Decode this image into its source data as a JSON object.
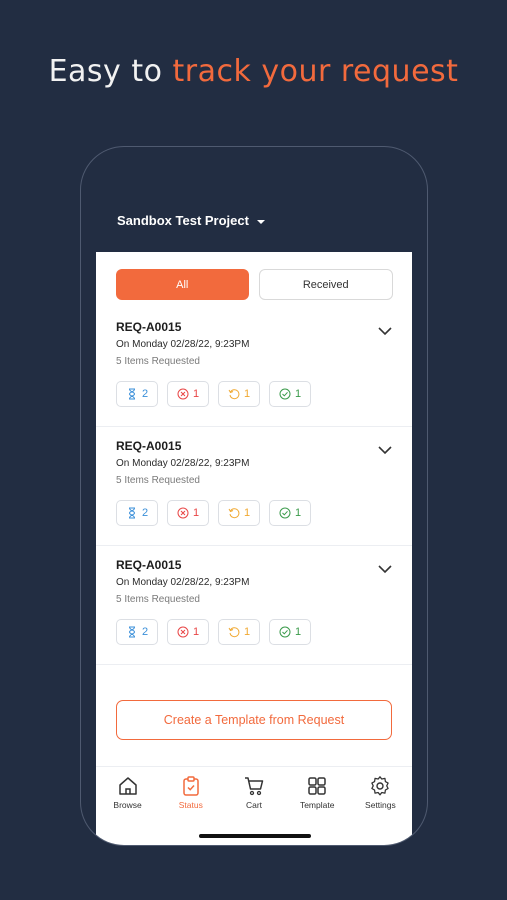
{
  "headline": {
    "plain": "Easy to ",
    "accent": "track your request"
  },
  "project": {
    "name": "Sandbox Test Project"
  },
  "tabs": [
    {
      "label": "All",
      "active": true
    },
    {
      "label": "Received",
      "active": false
    }
  ],
  "requests": [
    {
      "id": "REQ-A0015",
      "date": "On Monday 02/28/22, 9:23PM",
      "items": "5 Items Requested",
      "pending": "2",
      "rejected": "1",
      "processing": "1",
      "completed": "1"
    },
    {
      "id": "REQ-A0015",
      "date": "On Monday 02/28/22, 9:23PM",
      "items": "5 Items Requested",
      "pending": "2",
      "rejected": "1",
      "processing": "1",
      "completed": "1"
    },
    {
      "id": "REQ-A0015",
      "date": "On Monday 02/28/22, 9:23PM",
      "items": "5 Items Requested",
      "pending": "2",
      "rejected": "1",
      "processing": "1",
      "completed": "1"
    }
  ],
  "cta": {
    "label": "Create a Template from Request"
  },
  "nav": [
    {
      "label": "Browse",
      "icon": "home-icon"
    },
    {
      "label": "Status",
      "icon": "clipboard-check-icon",
      "active": true
    },
    {
      "label": "Cart",
      "icon": "cart-icon"
    },
    {
      "label": "Template",
      "icon": "grid-icon"
    },
    {
      "label": "Settings",
      "icon": "gear-icon"
    }
  ],
  "colors": {
    "accent": "#f26a3d",
    "background": "#222d42",
    "pending": "#3a8fd9",
    "rejected": "#e84545",
    "processing": "#f0a830",
    "completed": "#3a9a4a"
  }
}
